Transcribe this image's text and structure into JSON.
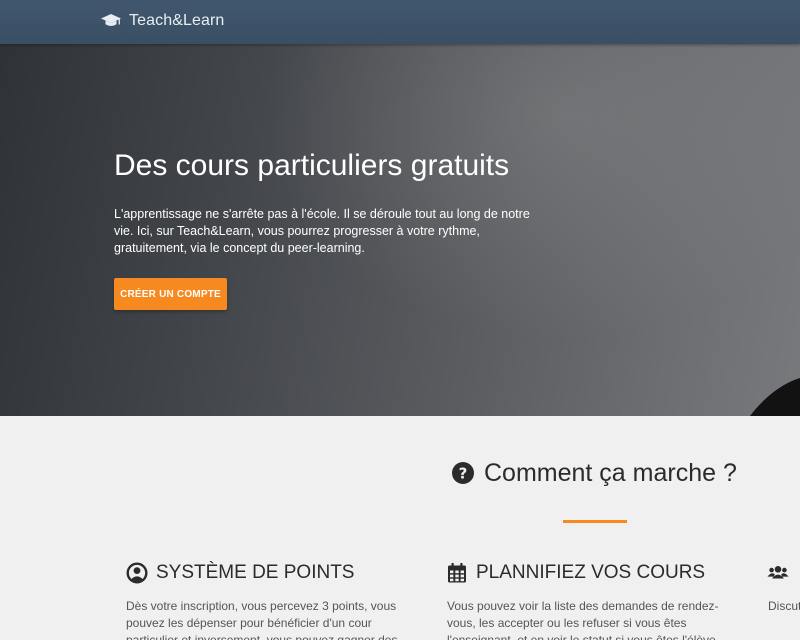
{
  "navbar": {
    "brand": "Teach&Learn",
    "brand_icon": "graduation-cap-icon"
  },
  "hero": {
    "title": "Des cours particuliers gratuits",
    "description": "L'apprentissage ne s'arrête pas à l'école. Il se déroule tout au long de notre vie. Ici, sur Teach&Learn, vous pourrez progresser à votre rythme, gratuitement, via le concept du peer-learning.",
    "cta_label": "CRÉER UN COMPTE"
  },
  "how": {
    "icon": "question-circle-icon",
    "title": "Comment ça marche ?"
  },
  "features": [
    {
      "icon": "user-circle-icon",
      "title": "SYSTÈME DE POINTS",
      "text": "Dès votre inscription, vous percevez 3 points, vous pouvez les dépenser pour bénéficier d'un cour particulier et inversement, vous pouvez gagner des points en"
    },
    {
      "icon": "calendar-icon",
      "title": "PLANNIFIEZ VOS COURS",
      "text": "Vous pouvez voir la liste des demandes de rendez-vous, les accepter ou les refuser si vous êtes l'enseignant, et en voir le statut si vous êtes l'élève."
    },
    {
      "icon": "users-icon",
      "title": "",
      "text": "Discutez avec les autres utilisateurs, proposez des cours ou engagez la conversation"
    }
  ],
  "colors": {
    "accent": "#f6891f",
    "navbar": "#3d5368",
    "background": "#f0f0f0"
  }
}
